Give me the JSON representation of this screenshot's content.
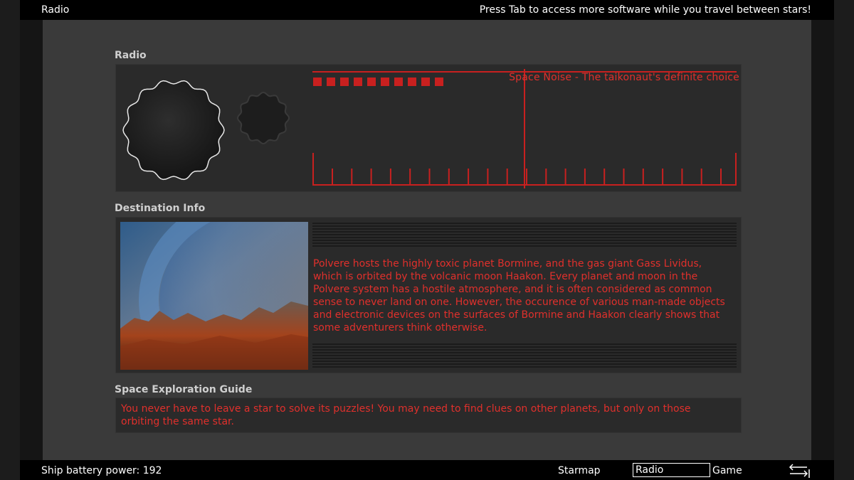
{
  "window": {
    "title": "Radio",
    "hint": "Press Tab to access more software while you travel between stars!"
  },
  "radio": {
    "section_title": "Radio",
    "station": "Space Noise - The taikonaut's definite choice",
    "signal_level": 10,
    "tuner_position": 0.5,
    "accent_color": "#e0302c"
  },
  "destination": {
    "section_title": "Destination Info",
    "description": "Polvere hosts the highly toxic planet Bormine, and the gas giant Gass Lividus, which is orbited by the volcanic moon Haakon. Every planet and moon in the Polvere system has a hostile atmosphere, and it is often considered as common sense to never land on one. However, the occurence of various man-made objects and electronic devices on the surfaces of Bormine and Haakon clearly shows that some adventurers think otherwise."
  },
  "guide": {
    "section_title": "Space Exploration Guide",
    "text": "You never have to leave a star to solve its puzzles! You may need to find clues on other planets, but only on those orbiting the same star."
  },
  "bottom_bar": {
    "battery_label": "Ship battery power:",
    "battery_value": "192",
    "nav": {
      "starmap": "Starmap",
      "radio": "Radio",
      "game": "Game"
    },
    "swap_icon": "switch-arrows-icon"
  }
}
